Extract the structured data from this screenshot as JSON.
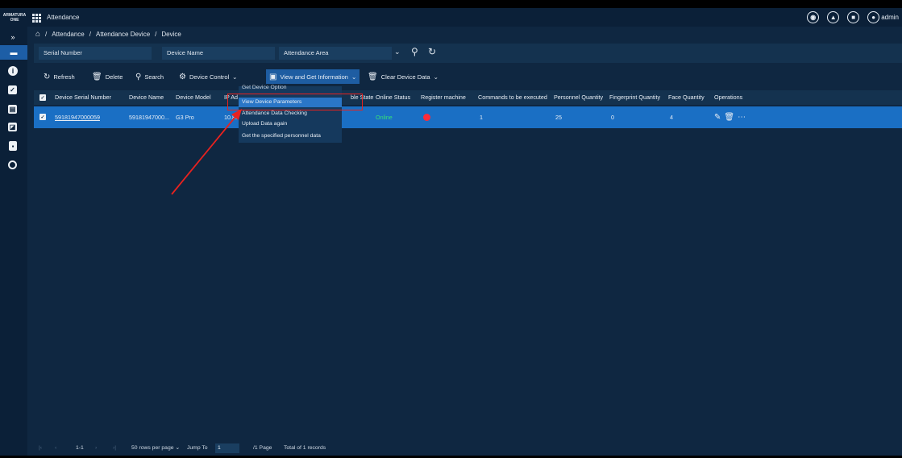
{
  "app": {
    "logo_line1": "ARMATURA",
    "logo_line2": "ONE",
    "title": "Attendance",
    "user": "admin"
  },
  "breadcrumb": [
    "/",
    "Attendance",
    "/",
    "Attendance Device",
    "/",
    "Device"
  ],
  "filters": {
    "serial_number": "Serial Number",
    "device_name": "Device Name",
    "attendance_area": "Attendance Area"
  },
  "toolbar": {
    "refresh": "Refresh",
    "delete": "Delete",
    "search": "Search",
    "device_control": "Device Control",
    "view_get_info": "View and Get Information",
    "clear_device_data": "Clear Device Data"
  },
  "table": {
    "headers": {
      "serial": "Device Serial Number",
      "name": "Device Name",
      "model": "Device Model",
      "ip": "IP Ad",
      "state": "ble State",
      "online": "Online Status",
      "register": "Register machine",
      "commands": "Commands to be executed",
      "personnel": "Personnel Quantity",
      "fingerprint": "Fingerprint Quantity",
      "face": "Face Quantity",
      "operations": "Operations"
    },
    "rows": [
      {
        "serial": "59181947000059",
        "name": "59181947000...",
        "model": "G3 Pro",
        "ip": "10.8.1",
        "online": "Online",
        "commands": "1",
        "personnel": "25",
        "fingerprint": "0",
        "face": "4"
      }
    ]
  },
  "dropdown": {
    "items": [
      "Get Device Option",
      "View Device Parameters",
      "Attendance Data Checking",
      "Upload Data again",
      "Get the specified personnel data"
    ],
    "selected": "View Device Parameters"
  },
  "pager": {
    "range": "1-1",
    "rows_per_page": "50 rows per page",
    "jump_to": "Jump To",
    "page_value": "1",
    "page_total": "/1 Page",
    "total": "Total of 1 records"
  },
  "colors": {
    "header_bg": "#0b2038",
    "main_bg": "#0f2741",
    "row_selected": "#1a6fc4",
    "dropdown_selected": "#2a76c7",
    "annotation_red": "#e8221f",
    "online_green": "#35e07a"
  },
  "icons": [
    "apps-grid-icon",
    "home-icon",
    "refresh-icon",
    "delete-icon",
    "search-icon",
    "device-control-icon",
    "view-info-icon",
    "clear-icon",
    "edit-icon",
    "trash-icon",
    "more-icon"
  ]
}
